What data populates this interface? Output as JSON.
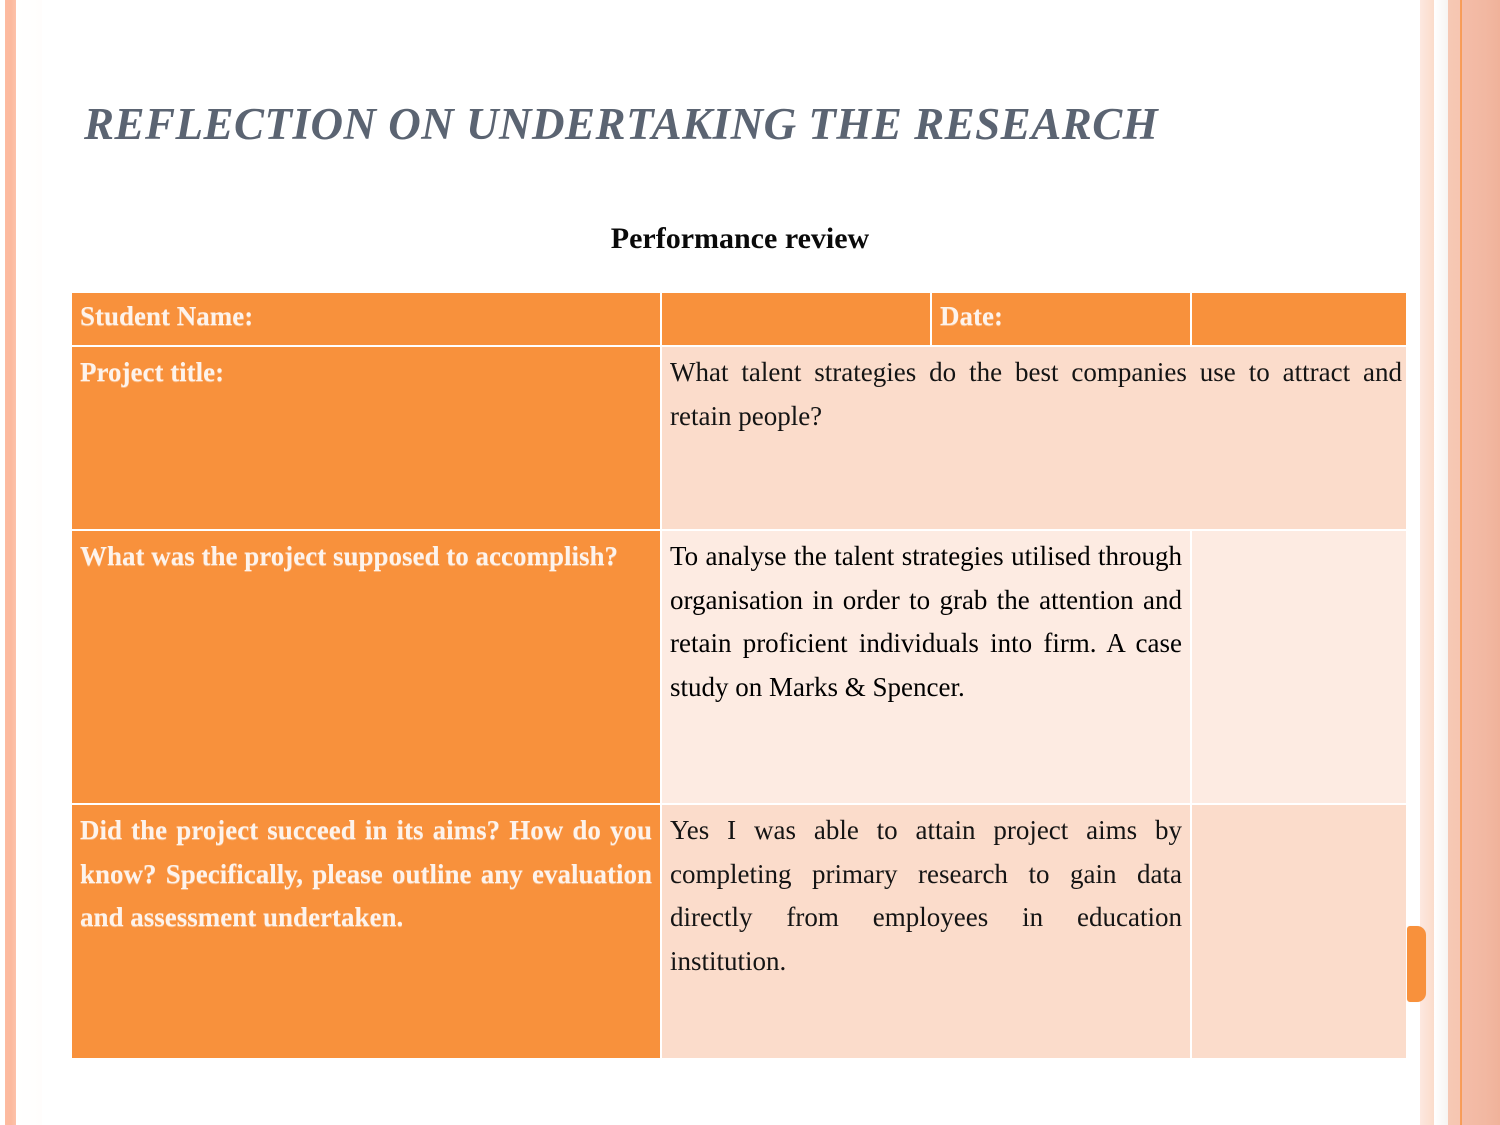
{
  "slide": {
    "title": "REFLECTION ON UNDERTAKING THE RESEARCH",
    "subtitle": "Performance review",
    "accent_color": "#F8913C",
    "title_color": "#5B6472",
    "cell_pink": "#FBDCCB",
    "cell_pink_light": "#FDEBE2"
  },
  "table": {
    "rows": [
      {
        "label": "Student Name:",
        "middle": "",
        "right_label": "Date:",
        "right_value": ""
      },
      {
        "label": "Project title:",
        "answer": "What talent strategies do the best companies use to attract and retain people?"
      },
      {
        "label": "What was the project supposed to accomplish?",
        "answer": "To analyse the talent strategies utilised through organisation in order to grab the attention and retain proficient individuals into firm. A case study on Marks & Spencer.",
        "extra": ""
      },
      {
        "label": "Did the project succeed in its aims? How do you know? Specifically, please outline any evaluation and assessment undertaken.",
        "answer": "Yes I was able to attain project aims by completing primary research to gain data directly from employees in education institution.",
        "extra": ""
      }
    ]
  }
}
